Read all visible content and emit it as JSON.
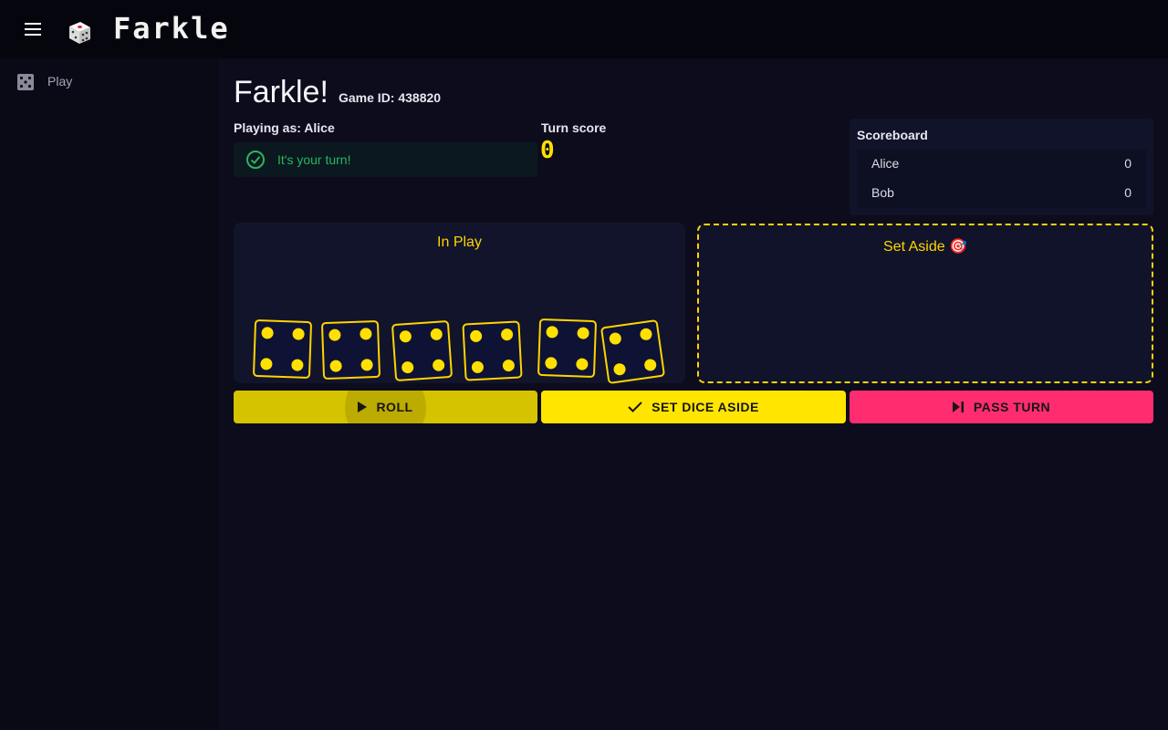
{
  "app": {
    "title": "Farkle",
    "logo_icon": "dice-logo-icon",
    "menu_icon": "hamburger-menu-icon"
  },
  "sidebar": {
    "items": [
      {
        "label": "Play",
        "icon": "dice-icon"
      }
    ]
  },
  "game": {
    "title": "Farkle!",
    "game_id": "Game ID: 438820",
    "playing_as_prefix": "Playing as: ",
    "player": "Alice",
    "turn_message": "It's your turn!",
    "turn_score_label": "Turn score",
    "turn_score": "0"
  },
  "scoreboard": {
    "title": "Scoreboard",
    "rows": [
      {
        "name": "Alice",
        "score": "0"
      },
      {
        "name": "Bob",
        "score": "0"
      }
    ]
  },
  "in_play": {
    "title": "In Play",
    "dice": [
      4,
      4,
      4,
      4,
      4,
      4
    ]
  },
  "set_aside": {
    "title": "Set Aside 🎯"
  },
  "actions": {
    "roll": "ROLL",
    "set_aside": "SET DICE ASIDE",
    "pass": "PASS TURN"
  },
  "colors": {
    "accent_yellow": "#ffe000",
    "success_green": "#27b65d",
    "pass_pink": "#ff2d6f",
    "background": "#0a0a17"
  }
}
